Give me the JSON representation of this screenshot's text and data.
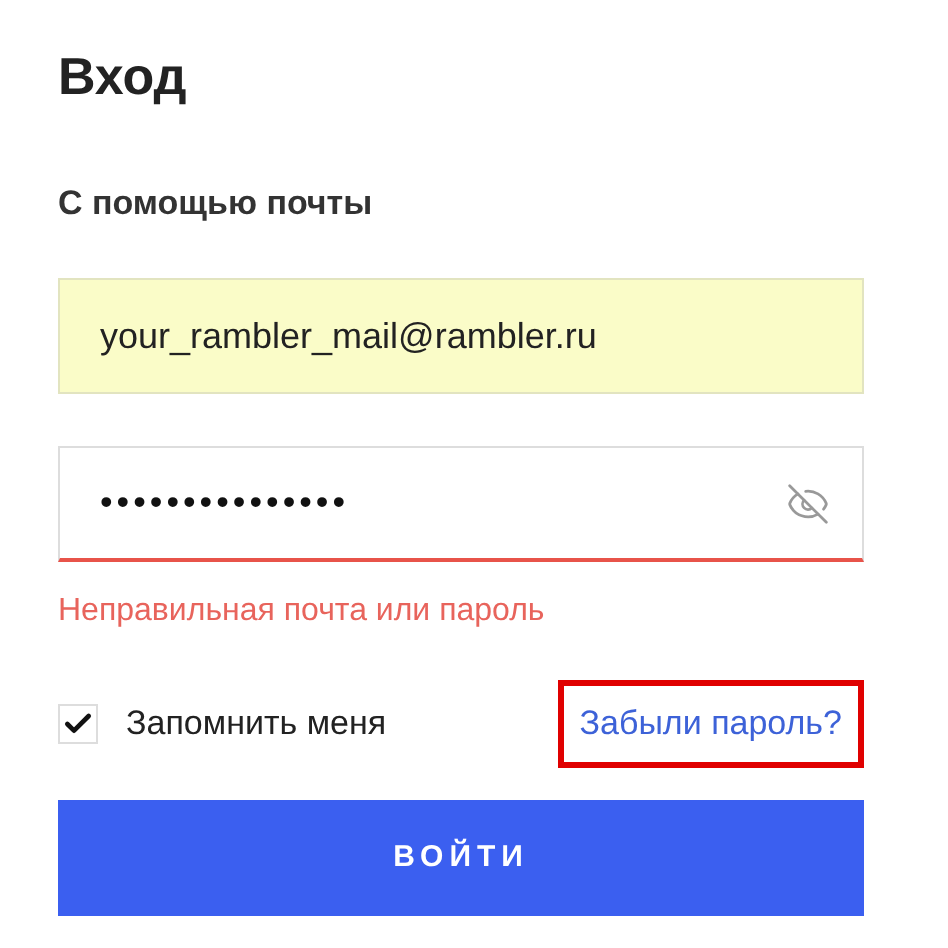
{
  "title": "Вход",
  "subtitle": "С помощью почты",
  "email_field": {
    "value": "your_rambler_mail@rambler.ru",
    "autofilled": true
  },
  "password_field": {
    "value": "•••••••••••••••",
    "error": true
  },
  "error_message": "Неправильная почта или пароль",
  "remember_me": {
    "label": "Запомнить меня",
    "checked": true
  },
  "forgot_link": {
    "label": "Забыли пароль?",
    "highlighted": true
  },
  "submit_button": {
    "label": "ВОЙТИ"
  }
}
